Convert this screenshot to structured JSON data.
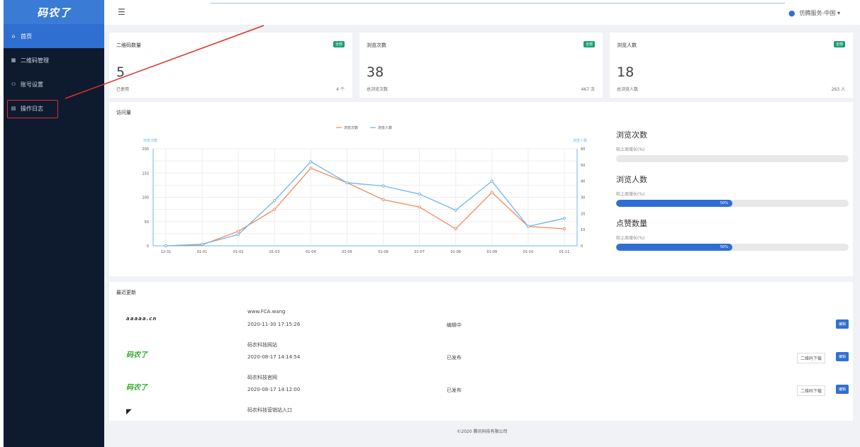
{
  "sidebar": {
    "logo_text": "码农了",
    "items": [
      {
        "label": "首页",
        "icon": "home-icon"
      },
      {
        "label": "二维码管理",
        "icon": "grid-icon"
      },
      {
        "label": "账号设置",
        "icon": "user-icon"
      },
      {
        "label": "操作日志",
        "icon": "log-icon"
      }
    ]
  },
  "header": {
    "menu_icon": "hamburger-icon",
    "user_label": "仿腾服务-中国 ▾"
  },
  "stats": [
    {
      "title": "二维码数量",
      "badge": "全部",
      "value": "5",
      "sub_label": "已使用",
      "sub_value": "4 个"
    },
    {
      "title": "浏览次数",
      "badge": "全部",
      "value": "38",
      "sub_label": "总浏览次数",
      "sub_value": "467 次"
    },
    {
      "title": "浏览人数",
      "badge": "全部",
      "value": "18",
      "sub_label": "总浏览人数",
      "sub_value": "263 人"
    }
  ],
  "visits": {
    "title": "访问量",
    "chart_data": {
      "type": "line",
      "categories": [
        "12-31",
        "01-01",
        "01-02",
        "01-03",
        "01-04",
        "01-05",
        "01-06",
        "01-07",
        "01-08",
        "01-09",
        "01-10",
        "01-11"
      ],
      "ylabel_left": "浏览次数",
      "ylabel_right": "浏览人数",
      "ylim_left": [
        0,
        200
      ],
      "ylim_right": [
        0,
        60
      ],
      "yticks_left": [
        "0",
        "50",
        "100",
        "150",
        "200"
      ],
      "yticks_right": [
        "0",
        "10",
        "20",
        "30",
        "40",
        "50",
        "60"
      ],
      "series": [
        {
          "name": "浏览次数",
          "axis": "left",
          "color": "#f08a5d",
          "values": [
            0,
            2,
            30,
            75,
            160,
            130,
            95,
            80,
            35,
            110,
            40,
            35
          ]
        },
        {
          "name": "浏览人数",
          "axis": "right",
          "color": "#6fb7e9",
          "values": [
            0,
            1,
            7,
            28,
            52,
            39,
            37,
            32,
            22,
            40,
            12,
            17
          ]
        }
      ],
      "grid": true,
      "legend": "top-center"
    },
    "progress": [
      {
        "title": "浏览次数",
        "sub": "较上周增长(%)",
        "percent": 0,
        "label": ""
      },
      {
        "title": "浏览人数",
        "sub": "较上周增长(%)",
        "percent": 50,
        "label": "50%"
      },
      {
        "title": "点赞数量",
        "sub": "较上周增长(%)",
        "percent": 50,
        "label": "50%"
      }
    ]
  },
  "recent": {
    "title": "最近更新",
    "rows": [
      {
        "logo": "aaaaa.cn",
        "name": "www.FCA.wang",
        "date": "2020-11-30 17:15:26",
        "status": "编辑中",
        "download": "",
        "edit": "编辑"
      },
      {
        "logo": "码农了",
        "name": "码农科技网站",
        "date": "2020-08-17 14:14:54",
        "status": "已发布",
        "download": "二维码下载",
        "edit": "编辑"
      },
      {
        "logo": "码农了",
        "name": "码农科技官网",
        "date": "2020-08-17 14:12:00",
        "status": "已发布",
        "download": "二维码下载",
        "edit": "编辑"
      },
      {
        "logo": "",
        "name": "码农科技营销站入口",
        "date": "",
        "status": "",
        "download": "",
        "edit": ""
      }
    ]
  },
  "footer": {
    "text": "©2020 腾讯科技有限公司"
  }
}
